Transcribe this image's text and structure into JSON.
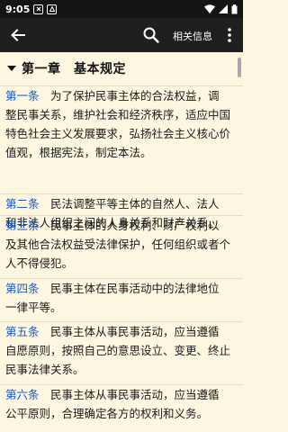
{
  "status_bar": {
    "time": "9:05"
  },
  "app_bar": {
    "related_info_label": "相关信息"
  },
  "chapter": {
    "title": "第一章　基本规定"
  },
  "articles": [
    {
      "label": "第一条",
      "line1": "　为了保护民事主体的合法权益，调",
      "rest": "整民事关系，维护社会和经济秩序，适应中国特色社会主义发展要求，弘扬社会主义核心价值观，根据宪法，制定本法。"
    },
    {
      "label": "第二条",
      "line1": "　民法调整平等主体的自然人、法人",
      "rest": "和非法人组织之间的人身关系和财产关系。"
    },
    {
      "label": "第三条",
      "line1": "　民事主体的人身权利、财产权利以",
      "rest": "及其他合法权益受法律保护，任何组织或者个人不得侵犯。"
    },
    {
      "label": "第四条",
      "line1": "　民事主体在民事活动中的法律地位",
      "rest": "一律平等。"
    },
    {
      "label": "第五条",
      "line1": "　民事主体从事民事活动，应当遵循",
      "rest": "自愿原则，按照自己的意思设立、变更、终止民事法律关系。"
    },
    {
      "label": "第六条",
      "line1": "　民事主体从事民事活动，应当遵循",
      "rest": "公平原则，合理确定各方的权利和义务。"
    }
  ]
}
